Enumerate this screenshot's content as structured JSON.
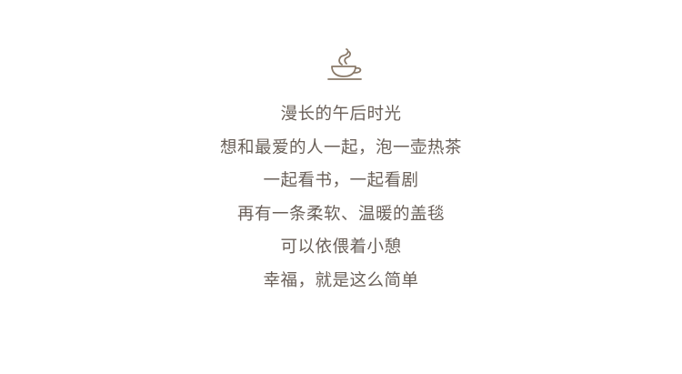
{
  "icon": {
    "name": "tea-cup-icon",
    "color": "#8a7a6a"
  },
  "text_color": "#6a6059",
  "poem": {
    "lines": [
      "漫长的午后时光",
      "想和最爱的人一起，泡一壶热茶",
      "一起看书，一起看剧",
      "再有一条柔软、温暖的盖毯",
      "可以依偎着小憩",
      "幸福，就是这么简单"
    ]
  }
}
